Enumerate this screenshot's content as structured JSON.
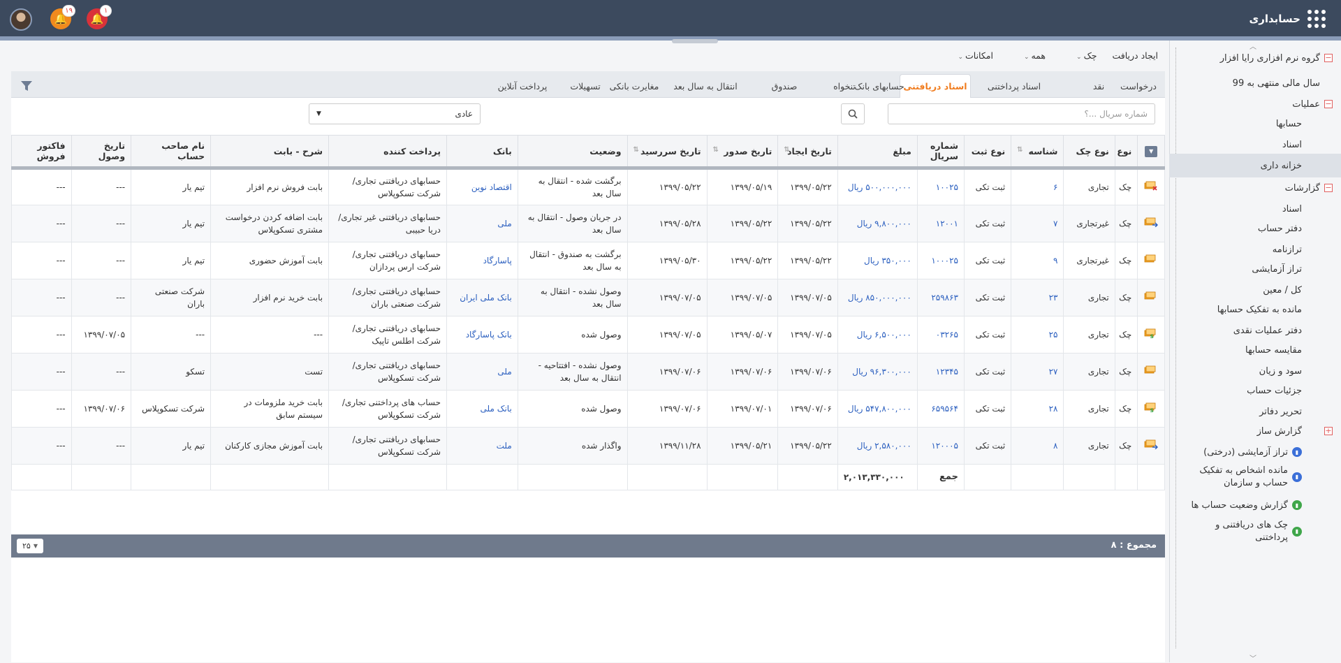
{
  "app": {
    "title": "حسابداری",
    "notif_orange": "۱۹",
    "notif_red": "۱"
  },
  "menu": [
    {
      "label": "ایجاد دریافت",
      "caret": false
    },
    {
      "label": "چک",
      "caret": true
    },
    {
      "label": "همه",
      "caret": true
    },
    {
      "label": "امکانات",
      "caret": true
    }
  ],
  "tabs": [
    "درخواست",
    "نقد",
    "اسناد پرداختنی",
    "اسناد دریافتنی",
    "حسابهای بانک",
    "تنخواه",
    "صندوق",
    "انتقال به سال بعد",
    "مغایرت بانکی",
    "تسهیلات",
    "پرداخت آنلاین"
  ],
  "active_tab": "اسناد دریافتنی",
  "search": {
    "placeholder": "شماره سریال ...؟"
  },
  "select": {
    "value": "عادی"
  },
  "columns": [
    "نوع",
    "نوع چک",
    "شناسه",
    "نوع ثبت",
    "شماره سریال",
    "مبلغ",
    "تاریخ ایجاد",
    "تاریخ صدور",
    "تاریخ سررسید",
    "وضعیت",
    "بانک",
    "پرداخت کننده",
    "شرح - بابت",
    "نام صاحب حساب",
    "تاریخ وصول",
    "فاکتور فروش"
  ],
  "rows": [
    {
      "icon": "cheque-returned-icon",
      "type": "چک",
      "cheque_type": "تجاری",
      "id": "۶",
      "reg": "ثبت تکی",
      "serial": "۱۰۰۲۵",
      "amount": "۵۰۰,۰۰۰,۰۰۰ ریال",
      "created": "۱۳۹۹/۰۵/۲۲",
      "issued": "۱۳۹۹/۰۵/۱۹",
      "due": "۱۳۹۹/۰۵/۲۲",
      "status": "برگشت شده - انتقال به سال بعد",
      "bank": "اقتصاد نوین",
      "payer": "حسابهای دریافتنی تجاری/شرکت تسکوپلاس",
      "desc": "بابت فروش نرم افزار",
      "holder": "تیم یار",
      "collected": "---",
      "invoice": "---"
    },
    {
      "icon": "cheque-transfer-icon",
      "type": "چک",
      "cheque_type": "غیرتجاری",
      "id": "۷",
      "reg": "ثبت تکی",
      "serial": "۱۲۰۰۱",
      "amount": "۹,۸۰۰,۰۰۰ ریال",
      "created": "۱۳۹۹/۰۵/۲۲",
      "issued": "۱۳۹۹/۰۵/۲۲",
      "due": "۱۳۹۹/۰۵/۲۸",
      "status": "در جریان وصول - انتقال به سال بعد",
      "bank": "ملی",
      "payer": "حسابهای دریافتنی غیر تجاری/دریا حبیبی",
      "desc": "بابت اضافه کردن درخواست مشتری تسکوپلاس",
      "holder": "تیم یار",
      "collected": "---",
      "invoice": "---"
    },
    {
      "icon": "cheque-icon",
      "type": "چک",
      "cheque_type": "غیرتجاری",
      "id": "۹",
      "reg": "ثبت تکی",
      "serial": "۱۰۰۰۲۵",
      "amount": "۳۵۰,۰۰۰ ریال",
      "created": "۱۳۹۹/۰۵/۲۲",
      "issued": "۱۳۹۹/۰۵/۲۲",
      "due": "۱۳۹۹/۰۵/۳۰",
      "status": "برگشت به صندوق - انتقال به سال بعد",
      "bank": "پاسارگاد",
      "payer": "حسابهای دریافتنی تجاری/شرکت ارس پردازان",
      "desc": "بابت آموزش حضوری",
      "holder": "تیم یار",
      "collected": "---",
      "invoice": "---"
    },
    {
      "icon": "cheque-icon",
      "type": "چک",
      "cheque_type": "تجاری",
      "id": "۲۳",
      "reg": "ثبت تکی",
      "serial": "۲۵۹۸۶۳",
      "amount": "۸۵۰,۰۰۰,۰۰۰ ریال",
      "created": "۱۳۹۹/۰۷/۰۵",
      "issued": "۱۳۹۹/۰۷/۰۵",
      "due": "۱۳۹۹/۰۷/۰۵",
      "status": "وصول نشده - انتقال به سال بعد",
      "bank": "بانک ملی ایران",
      "payer": "حسابهای دریافتنی تجاری/شرکت صنعتی باران",
      "desc": "بابت خرید نرم افزار",
      "holder": "شرکت صنعتی باران",
      "collected": "---",
      "invoice": "---"
    },
    {
      "icon": "cheque-collected-icon",
      "type": "چک",
      "cheque_type": "تجاری",
      "id": "۲۵",
      "reg": "ثبت تکی",
      "serial": "۰۳۲۶۵",
      "amount": "۶,۵۰۰,۰۰۰ ریال",
      "created": "۱۳۹۹/۰۷/۰۵",
      "issued": "۱۳۹۹/۰۵/۰۷",
      "due": "۱۳۹۹/۰۷/۰۵",
      "status": "وصول شده",
      "bank": "بانک پاسارگاد",
      "payer": "حسابهای دریافتنی تجاری/شرکت اطلس تاپیک",
      "desc": "---",
      "holder": "---",
      "collected": "۱۳۹۹/۰۷/۰۵",
      "invoice": "---"
    },
    {
      "icon": "cheque-icon",
      "type": "چک",
      "cheque_type": "تجاری",
      "id": "۲۷",
      "reg": "ثبت تکی",
      "serial": "۱۲۳۴۵",
      "amount": "۹۶,۳۰۰,۰۰۰ ریال",
      "created": "۱۳۹۹/۰۷/۰۶",
      "issued": "۱۳۹۹/۰۷/۰۶",
      "due": "۱۳۹۹/۰۷/۰۶",
      "status": "وصول نشده - افتتاحیه - انتقال به سال بعد",
      "bank": "ملی",
      "payer": "حسابهای دریافتنی تجاری/شرکت تسکوپلاس",
      "desc": "تست",
      "holder": "تسکو",
      "collected": "---",
      "invoice": "---"
    },
    {
      "icon": "cheque-collected-icon",
      "type": "چک",
      "cheque_type": "تجاری",
      "id": "۲۸",
      "reg": "ثبت تکی",
      "serial": "۶۵۹۵۶۴",
      "amount": "۵۴۷,۸۰۰,۰۰۰ ریال",
      "created": "۱۳۹۹/۰۷/۰۶",
      "issued": "۱۳۹۹/۰۷/۰۱",
      "due": "۱۳۹۹/۰۷/۰۶",
      "status": "وصول شده",
      "bank": "بانک ملی",
      "payer": "حساب های پرداختنی تجاری/شرکت تسکوپلاس",
      "desc": "بابت خرید ملزومات در سیستم سابق",
      "holder": "شرکت تسکوپلاس",
      "collected": "۱۳۹۹/۰۷/۰۶",
      "invoice": "---"
    },
    {
      "icon": "cheque-transfer-icon",
      "type": "چک",
      "cheque_type": "تجاری",
      "id": "۸",
      "reg": "ثبت تکی",
      "serial": "۱۲۰۰۰۵",
      "amount": "۲,۵۸۰,۰۰۰ ریال",
      "created": "۱۳۹۹/۰۵/۲۲",
      "issued": "۱۳۹۹/۰۵/۲۱",
      "due": "۱۳۹۹/۱۱/۲۸",
      "status": "واگذار شده",
      "bank": "ملت",
      "payer": "حسابهای دریافتنی تجاری/شرکت تسکوپلاس",
      "desc": "بابت آموزش مجازی کارکنان",
      "holder": "تیم یار",
      "collected": "---",
      "invoice": "---"
    }
  ],
  "total": {
    "label": "جمع",
    "amount": "۲,۰۱۳,۳۳۰,۰۰۰"
  },
  "footer": {
    "count_label": "مجموع : ۸",
    "page_size": "۲۵"
  },
  "sidebar": [
    {
      "label": "گروه نرم افزاری رایا افزار",
      "level": 0,
      "box": "−"
    },
    {
      "label": "سال مالی منتهی به 99",
      "level": 1
    },
    {
      "label": "عملیات",
      "level": 1,
      "box": "−"
    },
    {
      "label": "حسابها",
      "level": 2
    },
    {
      "label": "اسناد",
      "level": 2
    },
    {
      "label": "خزانه داری",
      "level": 2,
      "active": true
    },
    {
      "label": "گزارشات",
      "level": 1,
      "box": "−"
    },
    {
      "label": "اسناد",
      "level": 2
    },
    {
      "label": "دفتر حساب",
      "level": 2
    },
    {
      "label": "ترازنامه",
      "level": 2
    },
    {
      "label": "تراز آزمایشی",
      "level": 2
    },
    {
      "label": "کل / معین",
      "level": 2
    },
    {
      "label": "مانده به تفکیک حسابها",
      "level": 2
    },
    {
      "label": "دفتر عملیات نقدی",
      "level": 2
    },
    {
      "label": "مقایسه حسابها",
      "level": 2
    },
    {
      "label": "سود و زیان",
      "level": 2
    },
    {
      "label": "جزئیات حساب",
      "level": 2
    },
    {
      "label": "تحریر دفاتر",
      "level": 2
    },
    {
      "label": "گزارش ساز",
      "level": 2,
      "box": "+"
    },
    {
      "label": "تراز آزمایشی (درختی)",
      "level": 2,
      "ico": "blue"
    },
    {
      "label": "مانده اشخاص به تفکیک حساب و سازمان",
      "level": 2,
      "ico": "blue",
      "multi": true
    },
    {
      "label": "گزارش وضعیت حساب ها",
      "level": 2,
      "ico": "green"
    },
    {
      "label": "چک های دریافتنی و پرداختنی",
      "level": 2,
      "ico": "green",
      "multi": true
    }
  ]
}
